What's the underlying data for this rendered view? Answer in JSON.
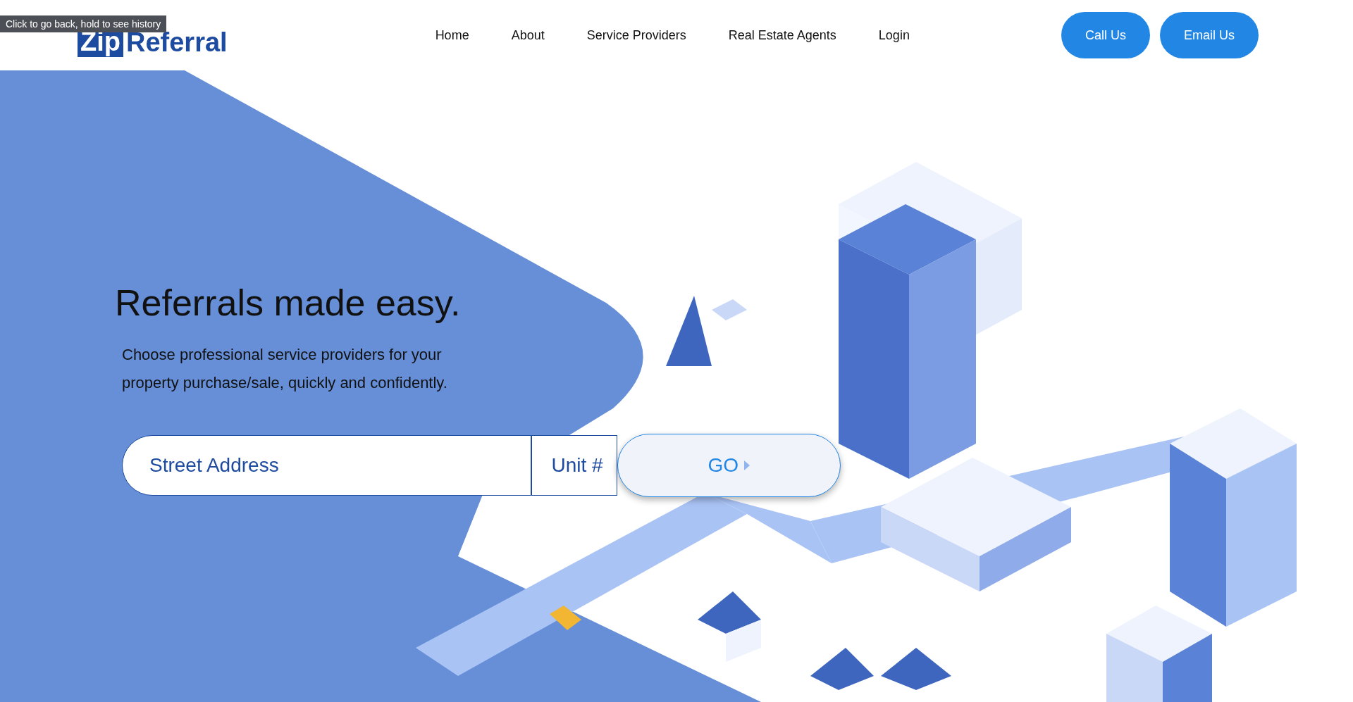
{
  "browser_tooltip": "Click to go back, hold to see history",
  "logo": {
    "part_1": "Zip",
    "part_2": "Referral"
  },
  "nav": [
    "Home",
    "About",
    "Service Providers",
    "Real Estate Agents",
    "Login"
  ],
  "header_buttons": [
    "Call Us",
    "Email Us"
  ],
  "hero": {
    "heading": "Referrals made easy.",
    "text": "Choose professional service providers for your property purchase/sale, quickly and confidently.",
    "search": {
      "street_placeholder": "Street Address",
      "unit_placeholder": "Unit #",
      "button": "GO"
    }
  }
}
